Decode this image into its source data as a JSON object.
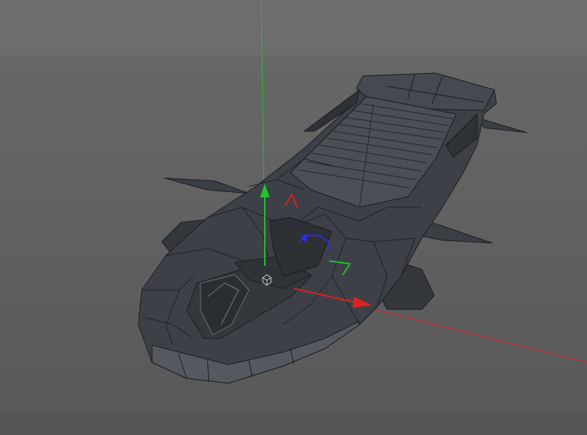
{
  "viewport": {
    "background_color": "#666666",
    "mesh_face_color": "#3c4046",
    "mesh_edge_color": "#1a1c1f",
    "mesh_highlight_color": "#5a5e63",
    "axis_colors": {
      "x": "#e0201f",
      "y": "#21c52b",
      "z": "#2b2ee0"
    },
    "selected_object": "spaceship-mesh",
    "icons": [
      "object-handle-icon",
      "move-x-arrow-icon",
      "move-y-arrow-icon",
      "rotate-handle-icon"
    ]
  }
}
